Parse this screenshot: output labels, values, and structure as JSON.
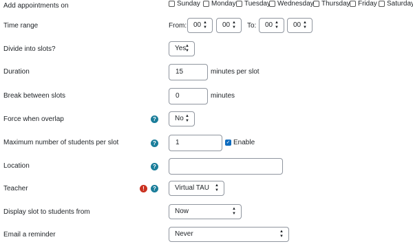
{
  "days": {
    "label": "Add appointments on",
    "items": [
      "Sunday",
      "Monday",
      "Tuesday",
      "Wednesday",
      "Thursday",
      "Friday",
      "Saturday"
    ]
  },
  "time_range": {
    "label": "Time range",
    "from_label": "From:",
    "from_hour": "00",
    "from_min": "00",
    "to_label": "To:",
    "to_hour": "00",
    "to_min": "00"
  },
  "divide": {
    "label": "Divide into slots?",
    "value": "Yes"
  },
  "duration": {
    "label": "Duration",
    "value": "15",
    "suffix": "minutes per slot"
  },
  "break": {
    "label": "Break between slots",
    "value": "0",
    "suffix": "minutes"
  },
  "force_overlap": {
    "label": "Force when overlap",
    "value": "No"
  },
  "max_students": {
    "label": "Maximum number of students per slot",
    "value": "1",
    "enable_label": "Enable"
  },
  "location": {
    "label": "Location",
    "value": ""
  },
  "teacher": {
    "label": "Teacher",
    "value": "Virtual TAU"
  },
  "display_from": {
    "label": "Display slot to students from",
    "value": "Now"
  },
  "email_reminder": {
    "label": "Email a reminder",
    "value": "Never"
  },
  "icons": {
    "help": "question-circle-icon",
    "required": "exclamation-circle-icon"
  },
  "colors": {
    "help": "#1a7d9a",
    "required": "#ca3120",
    "checkbox_checked": "#0f6cbf"
  }
}
